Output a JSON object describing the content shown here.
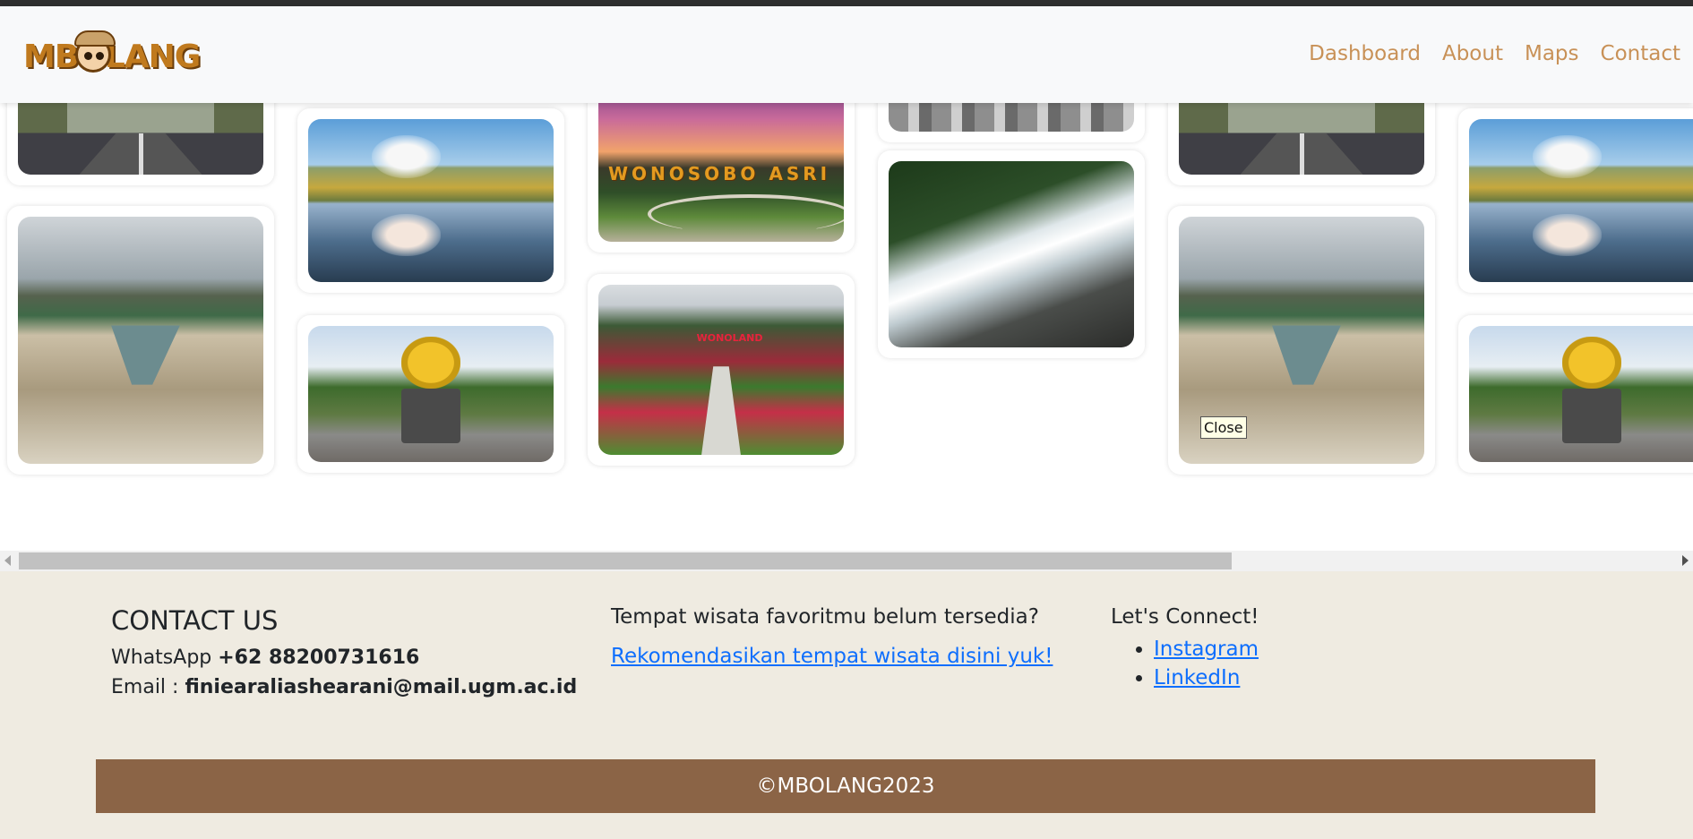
{
  "brand": {
    "logo_text": "MBOLANG"
  },
  "nav": [
    "Dashboard",
    "About",
    "Maps",
    "Contact"
  ],
  "gallery": {
    "photo_names": [
      "gate-road",
      "lake-steam",
      "wonosobo-sunset",
      "rock-lake",
      "durian-monument",
      "wonoland-garden",
      "waterfall",
      "tile-pattern"
    ],
    "sunset_sign": "WONOSOBO ASRI",
    "tooltip": "Close"
  },
  "footer": {
    "contact": {
      "title": "CONTACT US",
      "whatsapp_label": "WhatsApp",
      "whatsapp_number": "+62 88200731616",
      "email_label": "Email :",
      "email": "finiearaliashearani@mail.ugm.ac.id"
    },
    "recommend": {
      "title": "Tempat wisata favoritmu belum tersedia?",
      "link": "Rekomendasikan tempat wisata disini yuk!"
    },
    "connect": {
      "title": "Let's Connect!",
      "links": [
        "Instagram",
        "LinkedIn"
      ]
    },
    "copyright": "©MBOLANG2023"
  },
  "colors": {
    "nav_link": "#c89157",
    "footer_bg": "#efebe1",
    "copyright_bg": "#8b6446",
    "link": "#0d6efd"
  }
}
